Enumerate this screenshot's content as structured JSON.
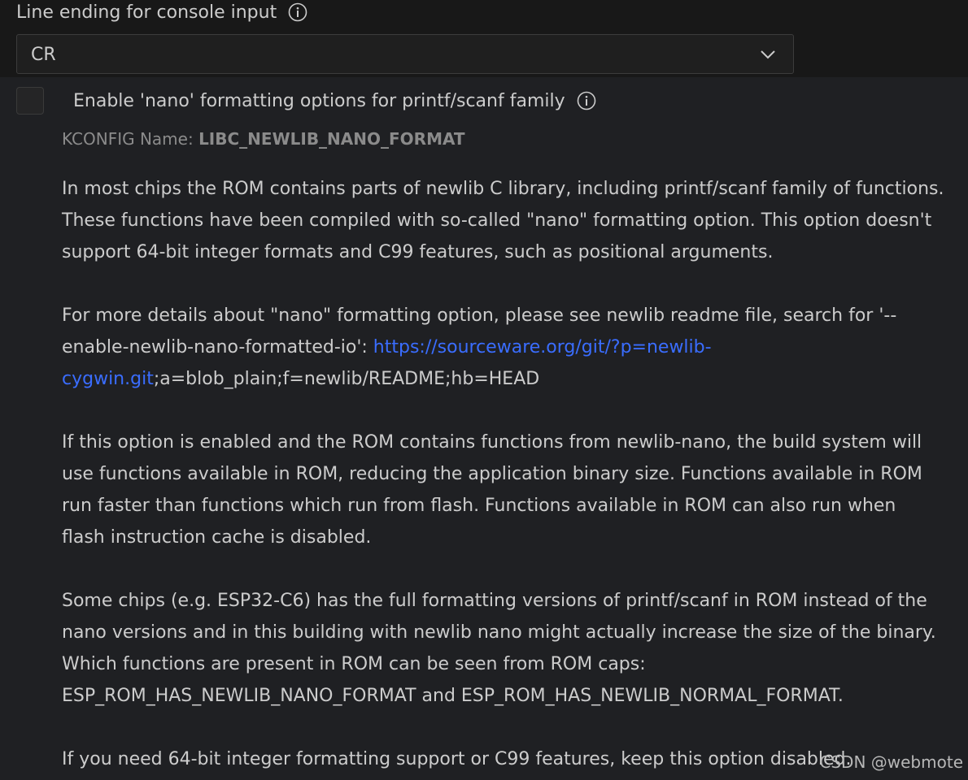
{
  "line_ending": {
    "label": "Line ending for console input",
    "selected": "CR"
  },
  "nano_setting": {
    "checked": false,
    "title": "Enable 'nano' formatting options for printf/scanf family",
    "kconfig_label": "KCONFIG Name:",
    "kconfig_value": "LIBC_NEWLIB_NANO_FORMAT",
    "para1": "In most chips the ROM contains parts of newlib C library, including printf/scanf family of functions. These functions have been compiled with so-called \"nano\" formatting option. This option doesn't support 64-bit integer formats and C99 features, such as positional arguments.",
    "para2_before_link": "For more details about \"nano\" formatting option, please see newlib readme file, search for '--enable-newlib-nano-formatted-io':",
    "para2_link": "https://sourceware.org/git/?p=newlib-cygwin.git",
    "para2_after_link": ";a=blob_plain;f=newlib/README;hb=HEAD",
    "para3": "If this option is enabled and the ROM contains functions from newlib-nano, the build system will use functions available in ROM, reducing the application binary size. Functions available in ROM run faster than functions which run from flash. Functions available in ROM can also run when flash instruction cache is disabled.",
    "para4": "Some chips (e.g. ESP32-C6) has the full formatting versions of printf/scanf in ROM instead of the nano versions and in this building with newlib nano might actually increase the size of the binary. Which functions are present in ROM can be seen from ROM caps: ESP_ROM_HAS_NEWLIB_NANO_FORMAT and ESP_ROM_HAS_NEWLIB_NORMAL_FORMAT.",
    "para5": "If you need 64-bit integer formatting support or C99 features, keep this option disabled."
  },
  "watermark": "CSDN @webmote",
  "colors": {
    "link": "#3a6dff",
    "background": "#1f2023",
    "top_background": "#181818",
    "text": "#cccccc"
  },
  "icons": [
    "info-icon",
    "chevron-down-icon"
  ]
}
